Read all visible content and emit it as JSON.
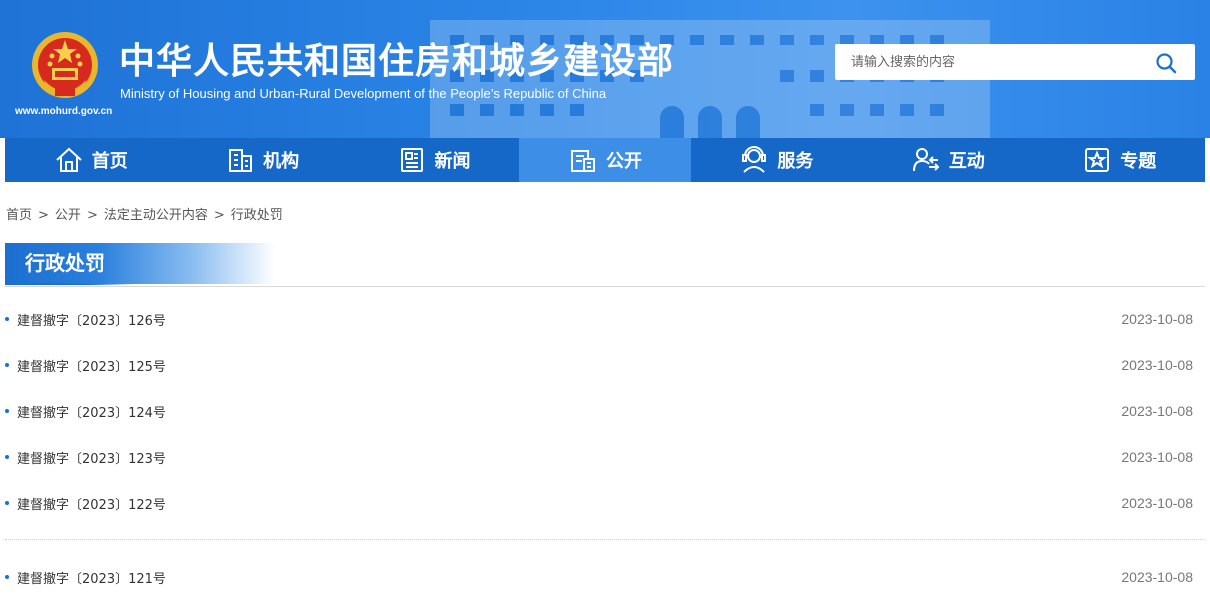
{
  "header": {
    "title_cn": "中华人民共和国住房和城乡建设部",
    "title_en": "Ministry of Housing and Urban-Rural Development of the People’s Republic of China",
    "site_url": "www.mohurd.gov.cn",
    "logo_icon": "national-emblem-icon"
  },
  "search": {
    "placeholder": "请输入搜索的内容",
    "button_icon": "search-icon"
  },
  "nav": {
    "items": [
      {
        "label": "首页",
        "icon": "home-icon"
      },
      {
        "label": "机构",
        "icon": "building-icon"
      },
      {
        "label": "新闻",
        "icon": "newspaper-icon"
      },
      {
        "label": "公开",
        "icon": "document-icon",
        "active": true
      },
      {
        "label": "服务",
        "icon": "service-person-icon"
      },
      {
        "label": "互动",
        "icon": "interaction-icon"
      },
      {
        "label": "专题",
        "icon": "star-box-icon"
      }
    ]
  },
  "breadcrumb": {
    "items": [
      "首页",
      "公开",
      "法定主动公开内容",
      "行政处罚"
    ],
    "separator": ">"
  },
  "section": {
    "title": "行政处罚"
  },
  "list": {
    "items": [
      {
        "title": "建督撤字〔2023〕126号",
        "date": "2023-10-08"
      },
      {
        "title": "建督撤字〔2023〕125号",
        "date": "2023-10-08"
      },
      {
        "title": "建督撤字〔2023〕124号",
        "date": "2023-10-08"
      },
      {
        "title": "建督撤字〔2023〕123号",
        "date": "2023-10-08"
      },
      {
        "title": "建督撤字〔2023〕122号",
        "date": "2023-10-08"
      },
      {
        "title": "建督撤字〔2023〕121号",
        "date": "2023-10-08"
      }
    ]
  },
  "colors": {
    "brand_blue": "#1f72d6",
    "nav_blue": "#1668c8",
    "nav_active": "#3d8ee6",
    "bullet": "#1d6fd2"
  }
}
